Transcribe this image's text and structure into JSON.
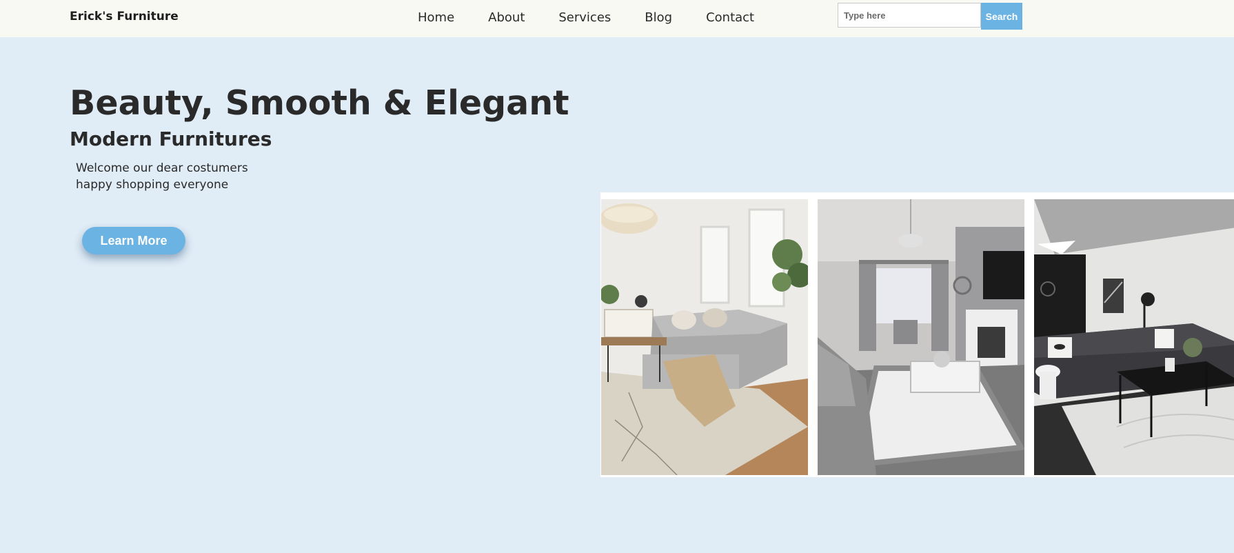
{
  "brand": {
    "name": "Erick's Furniture"
  },
  "nav": {
    "items": [
      {
        "label": "Home"
      },
      {
        "label": "About"
      },
      {
        "label": "Services"
      },
      {
        "label": "Blog"
      },
      {
        "label": "Contact"
      }
    ]
  },
  "search": {
    "placeholder": "Type here",
    "value": "",
    "button_label": "Search"
  },
  "hero": {
    "title": "Beauty, Smooth & Elegant",
    "subtitle": "Modern Furnitures",
    "welcome_line_1": "Welcome our dear costumers",
    "welcome_line_2": "happy shopping everyone",
    "cta_label": "Learn More"
  },
  "gallery": {
    "photos": [
      {
        "icon": "living-room-photo-bright"
      },
      {
        "icon": "living-room-photo-grey"
      },
      {
        "icon": "living-room-photo-dark"
      }
    ]
  },
  "colors": {
    "page_background": "#e0ecf6",
    "navbar_background": "#f9f9f4",
    "accent": "#6ab3e3",
    "text": "#2a2a2a"
  }
}
